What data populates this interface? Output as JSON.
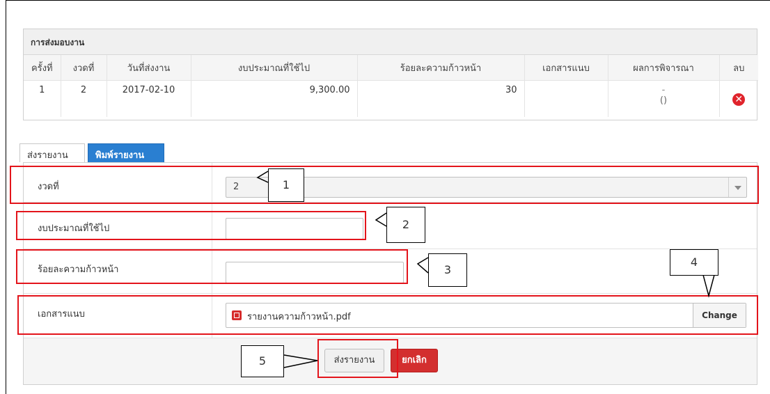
{
  "submissions": {
    "title": "การส่งมอบงาน",
    "columns": [
      "ครั้งที่",
      "งวดที่",
      "วันที่ส่งงาน",
      "งบประมาณที่ใช้ไป",
      "ร้อยละความก้าวหน้า",
      "เอกสารแนบ",
      "ผลการพิจารณา",
      "ลบ"
    ],
    "rows": [
      {
        "no": "1",
        "period": "2",
        "date": "2017-02-10",
        "budget": "9,300.00",
        "progress": "30",
        "attachment": "",
        "result_line1": "-",
        "result_line2": "()",
        "delete_icon": "delete-x-icon"
      }
    ]
  },
  "tabs": [
    {
      "label": "ส่งรายงาน",
      "active": false
    },
    {
      "label": "พิมพ์รายงาน",
      "active": true
    }
  ],
  "form": {
    "period_label": "งวดที่",
    "period_value": "2",
    "budget_label": "งบประมาณที่ใช้ไป",
    "budget_value": "",
    "progress_label": "ร้อยละความก้าวหน้า",
    "progress_value": "",
    "attachment_label": "เอกสารแนบ",
    "attachment_file": "รายงานความก้าวหน้า.pdf",
    "change_label": "Change",
    "submit_label": "ส่งรายงาน",
    "cancel_label": "ยกเลิก"
  },
  "callouts": [
    "1",
    "2",
    "3",
    "4",
    "5"
  ],
  "colors": {
    "highlight": "#e3141b",
    "tab_active": "#2a7fd1",
    "cancel": "#d32f2f",
    "delete": "#e0242c"
  }
}
